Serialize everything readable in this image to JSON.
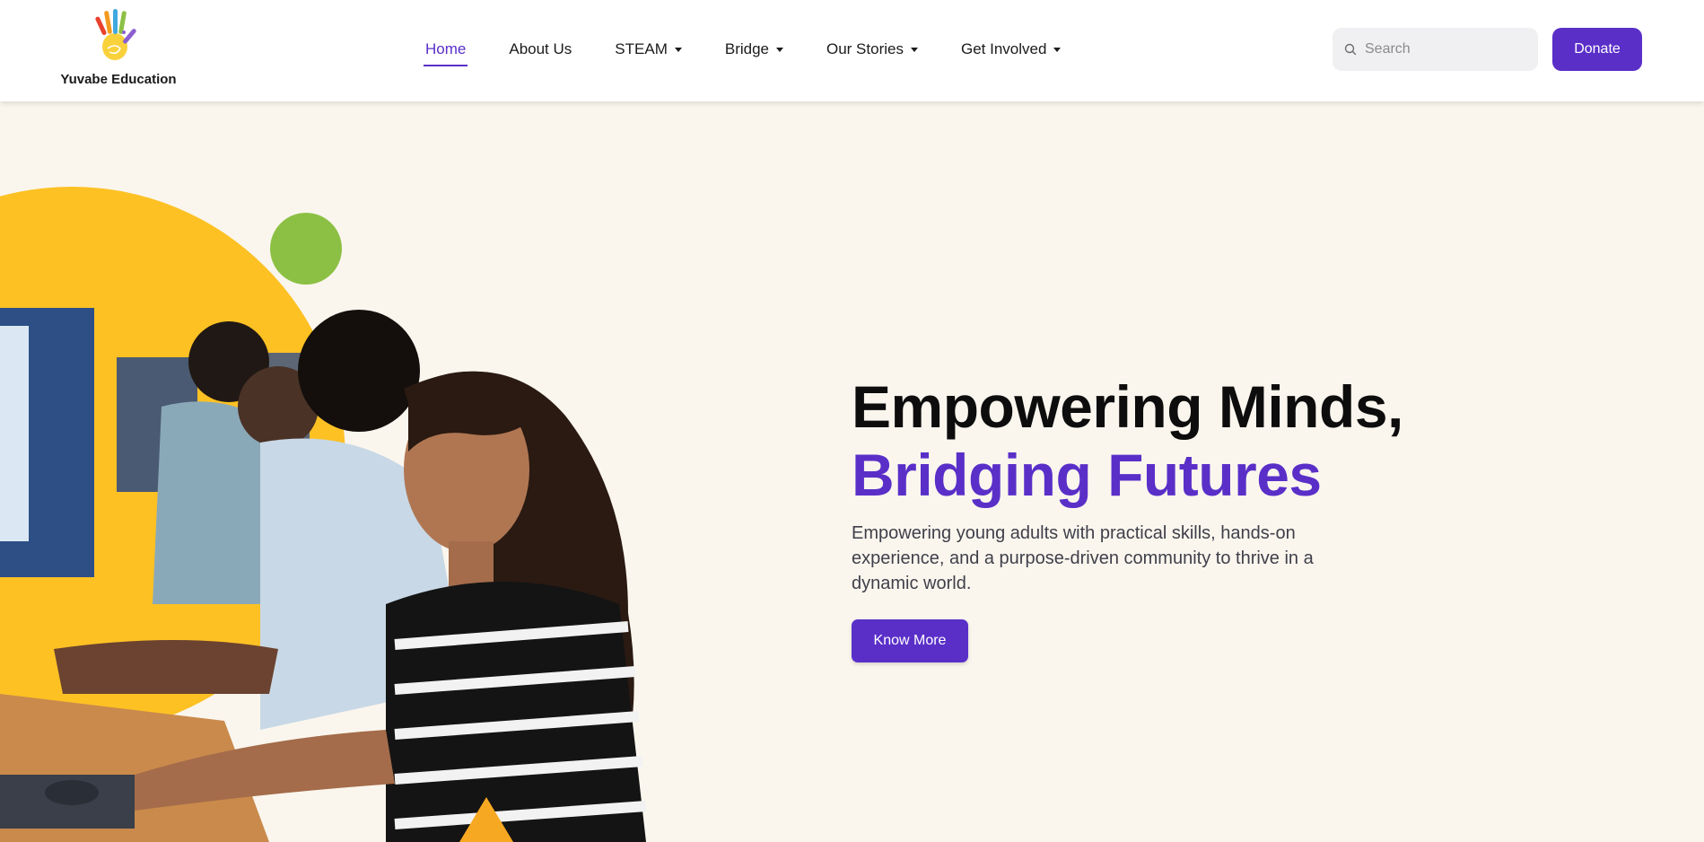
{
  "brand": {
    "name": "Yuvabe Education",
    "logo_icon": "hand-logo-icon",
    "accent_color": "#5a2fc8"
  },
  "nav": {
    "items": [
      {
        "label": "Home",
        "active": true,
        "has_dropdown": false
      },
      {
        "label": "About Us",
        "active": false,
        "has_dropdown": false
      },
      {
        "label": "STEAM",
        "active": false,
        "has_dropdown": true
      },
      {
        "label": "Bridge",
        "active": false,
        "has_dropdown": true
      },
      {
        "label": "Our Stories",
        "active": false,
        "has_dropdown": true
      },
      {
        "label": "Get Involved",
        "active": false,
        "has_dropdown": true
      }
    ]
  },
  "search": {
    "placeholder": "Search",
    "value": "",
    "icon": "search-icon"
  },
  "donate_label": "Donate",
  "hero": {
    "title_line1": "Empowering Minds,",
    "title_line2": "Bridging Futures",
    "subtitle": "Empowering young adults with practical skills, hands-on experience, and a purpose-driven community to thrive in a dynamic world.",
    "cta_label": "Know More",
    "colors": {
      "yellow": "#fdc124",
      "green": "#8cc044",
      "orange": "#f7a823"
    }
  }
}
